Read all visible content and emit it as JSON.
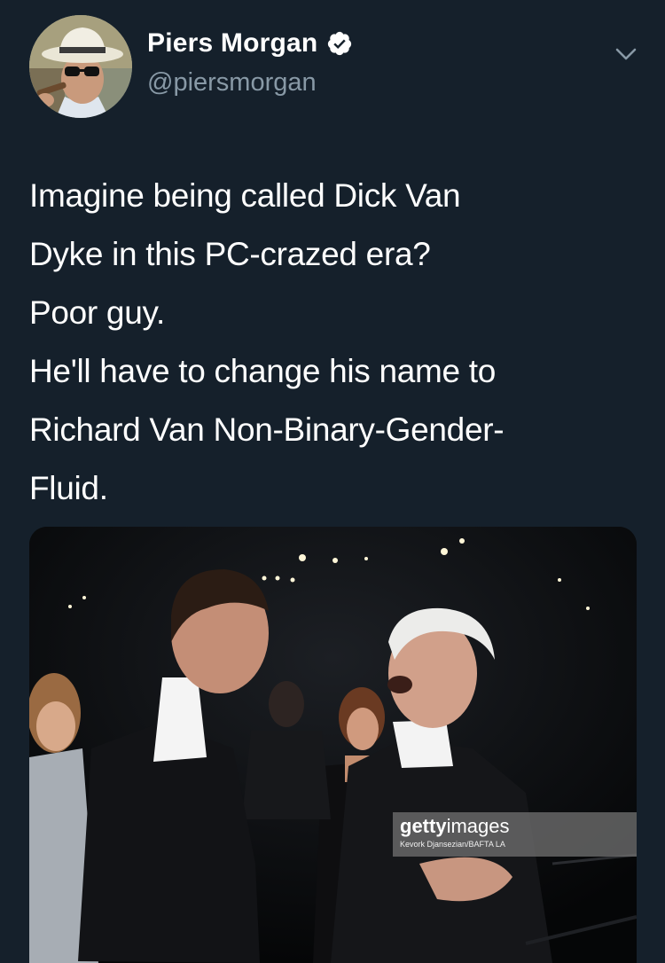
{
  "author": {
    "display_name": "Piers Morgan",
    "handle": "@piersmorgan",
    "verified": true,
    "verified_icon": "verified-badge-icon"
  },
  "menu": {
    "icon": "chevron-down-icon"
  },
  "tweet": {
    "lines": [
      "Imagine being called Dick Van",
      "Dyke in this PC-crazed era?",
      "Poor guy.",
      "He'll have to change his name to",
      "Richard Van Non-Binary-Gender-",
      "Fluid."
    ]
  },
  "media": {
    "watermark_brand_bold": "getty",
    "watermark_brand_regular": "images",
    "watermark_credit": "Kevork Djansezian/BAFTA LA"
  },
  "colors": {
    "background": "#15202b",
    "secondary_text": "#8899a6",
    "verified_blue": "#1da1f2"
  }
}
